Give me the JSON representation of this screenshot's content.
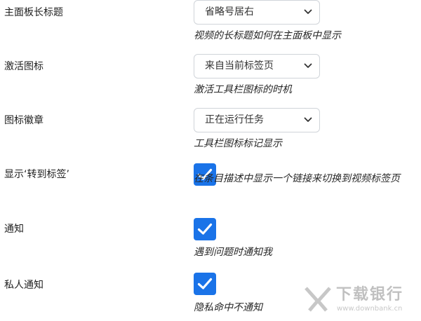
{
  "settings": [
    {
      "label": "主面板长标题",
      "control": "select",
      "value": "省略号居右",
      "description": "视频的长标题如何在主面板中显示"
    },
    {
      "label": "激活图标",
      "control": "select",
      "value": "来自当前标签页",
      "description": "激活工具栏图标的时机"
    },
    {
      "label": "图标徽章",
      "control": "select",
      "value": "正在运行任务",
      "description": "工具栏图标标记显示"
    },
    {
      "label": "显示‘转到标签’",
      "control": "checkbox",
      "checked": true,
      "description": "在条目描述中显示一个链接来切换到视频标签页"
    },
    {
      "label": "通知",
      "control": "checkbox",
      "checked": true,
      "description": "遇到问题时通知我"
    },
    {
      "label": "私人通知",
      "control": "checkbox",
      "checked": true,
      "description": "隐私命中不通知"
    }
  ],
  "watermark": {
    "name": "下载银行",
    "url": "www.downbank.cn"
  },
  "colors": {
    "checkbox_accent": "#1a73e8",
    "select_border": "#d0d4d9"
  },
  "icons": {
    "select_arrow": "chevron-down-icon",
    "checkbox_mark": "checkmark-icon"
  }
}
